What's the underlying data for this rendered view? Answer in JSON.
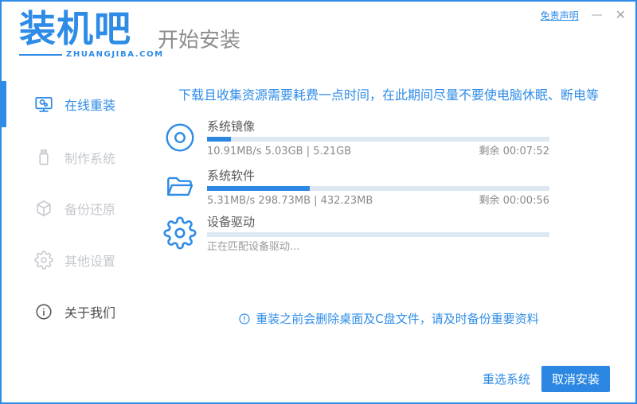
{
  "window": {
    "disclaimer": "免责声明",
    "minimize_glyph": "—",
    "close_glyph": "✕"
  },
  "logo": {
    "name": "装机吧",
    "domain": "ZHUANGJIBA.COM"
  },
  "header": {
    "title": "开始安装"
  },
  "sidebar": {
    "items": [
      {
        "label": "在线重装",
        "icon": "monitor-icon",
        "active": true
      },
      {
        "label": "制作系统",
        "icon": "usb-drive-icon",
        "active": false
      },
      {
        "label": "备份还原",
        "icon": "backup-box-icon",
        "active": false
      },
      {
        "label": "其他设置",
        "icon": "gear-icon",
        "active": false
      },
      {
        "label": "关于我们",
        "icon": "info-icon",
        "active": false
      }
    ]
  },
  "main": {
    "warning": "下载且收集资源需要耗费一点时间，在此期间尽量不要使电脑休眠、断电等",
    "tasks": [
      {
        "name": "系统镜像",
        "icon": "disc-icon",
        "progress_percent": 7,
        "stats": "10.91MB/s 5.03GB | 5.21GB",
        "remaining": "剩余 00:07:52"
      },
      {
        "name": "系统软件",
        "icon": "folder-icon",
        "progress_percent": 30,
        "stats": "5.31MB/s 298.73MB | 432.23MB",
        "remaining": "剩余 00:00:56"
      },
      {
        "name": "设备驱动",
        "icon": "gear-icon",
        "progress_percent": 0,
        "stats": "正在匹配设备驱动...",
        "remaining": ""
      }
    ],
    "note": "重装之前会删除桌面及C盘文件，请及时备份重要资料",
    "note_icon": "alert-circle-icon"
  },
  "footer": {
    "reselect_label": "重选系统",
    "cancel_label": "取消安装"
  },
  "colors": {
    "accent": "#2e8be6",
    "button": "#2b87e2",
    "track": "#dee8f2",
    "warning": "#2f8de8"
  }
}
